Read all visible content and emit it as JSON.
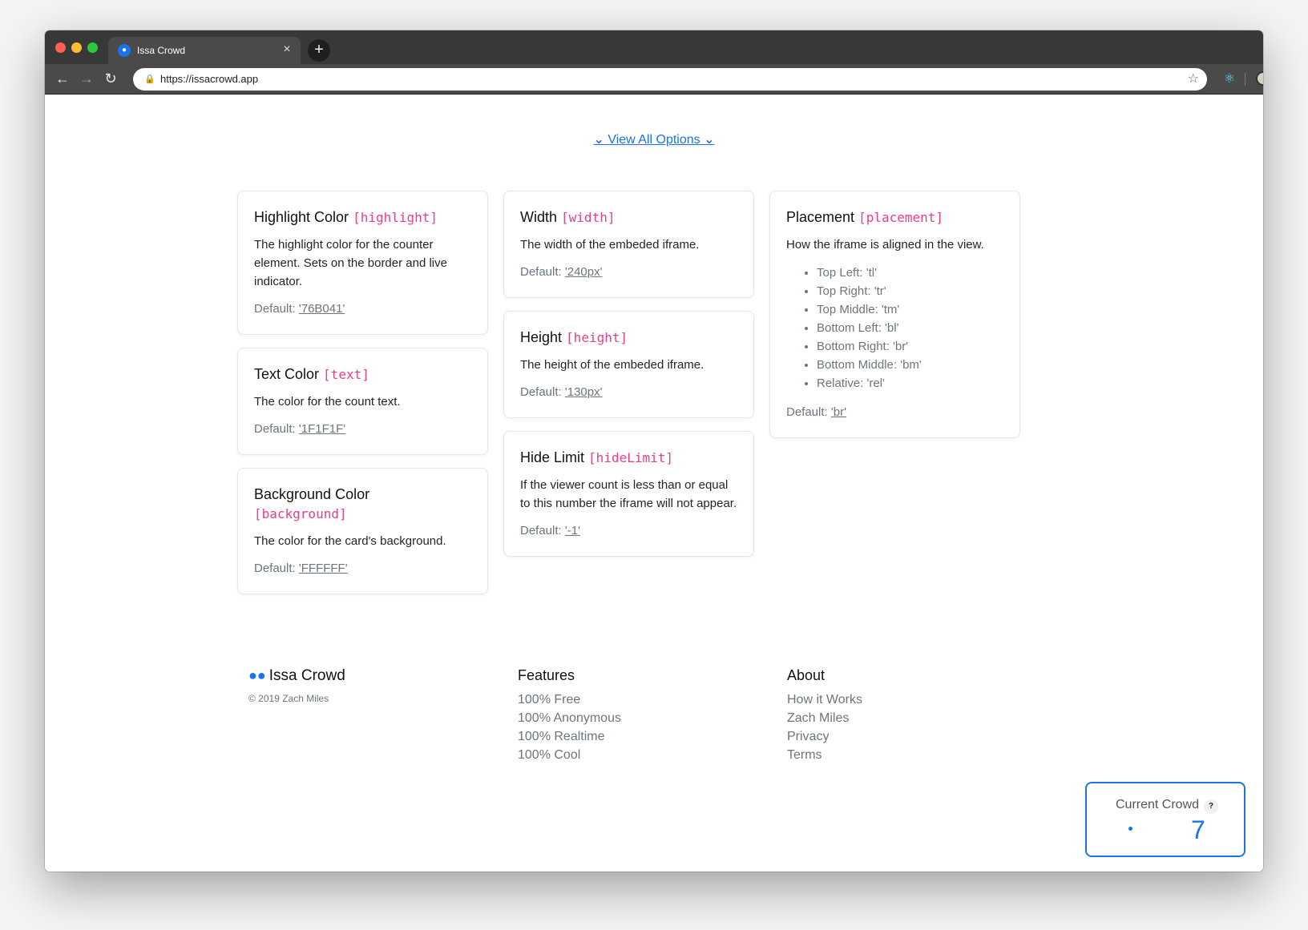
{
  "browser": {
    "tab_title": "Issa Crowd",
    "url": "https://issacrowd.app"
  },
  "view_all": "View All Options",
  "default_label": "Default:",
  "cards": {
    "highlight": {
      "title": "Highlight Color",
      "code": "[highlight]",
      "desc": "The highlight color for the counter element. Sets on the border and live indicator.",
      "default": "'76B041'"
    },
    "text": {
      "title": "Text Color",
      "code": "[text]",
      "desc": "The color for the count text.",
      "default": "'1F1F1F'"
    },
    "background": {
      "title": "Background Color",
      "code": "[background]",
      "desc": "The color for the card's background.",
      "default": "'FFFFFF'"
    },
    "width": {
      "title": "Width",
      "code": "[width]",
      "desc": "The width of the embeded iframe.",
      "default": "'240px'"
    },
    "height": {
      "title": "Height",
      "code": "[height]",
      "desc": "The height of the embeded iframe.",
      "default": "'130px'"
    },
    "hideLimit": {
      "title": "Hide Limit",
      "code": "[hideLimit]",
      "desc": "If the viewer count is less than or equal to this number the iframe will not appear.",
      "default": "'-1'"
    },
    "placement": {
      "title": "Placement",
      "code": "[placement]",
      "desc": "How the iframe is aligned in the view.",
      "options": [
        "Top Left: 'tl'",
        "Top Right: 'tr'",
        "Top Middle: 'tm'",
        "Bottom Left: 'bl'",
        "Bottom Right: 'br'",
        "Bottom Middle: 'bm'",
        "Relative: 'rel'"
      ],
      "default": "'br'"
    }
  },
  "footer": {
    "brand": "Issa Crowd",
    "copyright": "© 2019 Zach Miles",
    "features": {
      "heading": "Features",
      "links": [
        "100% Free",
        "100% Anonymous",
        "100% Realtime",
        "100% Cool"
      ]
    },
    "about": {
      "heading": "About",
      "links": [
        "How it Works",
        "Zach Miles",
        "Privacy",
        "Terms"
      ]
    }
  },
  "widget": {
    "label": "Current Crowd",
    "help": "?",
    "count": "7"
  },
  "colors": {
    "accent": "#1a73e8",
    "code": "#e83e8c"
  }
}
